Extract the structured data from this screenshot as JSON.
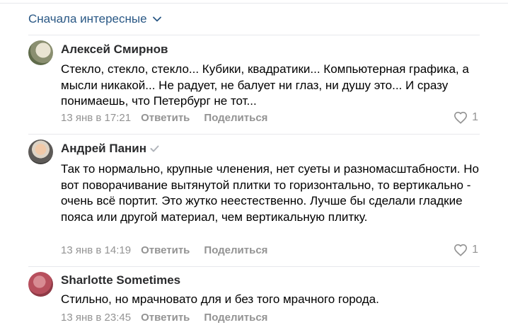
{
  "sort": {
    "label": "Сначала интересные"
  },
  "comments": [
    {
      "author": "Алексей Смирнов",
      "verified": false,
      "text": "Стекло, стекло, стекло... Кубики, квадратики... Компьютерная графика, а мысли никакой... Не радует, не балует ни глаз, ни душу это... И сразу понимаешь, что Петербург не тот...",
      "date": "13 янв в 17:21",
      "reply": "Ответить",
      "share": "Поделиться",
      "likes": "1"
    },
    {
      "author": "Андрей Панин",
      "verified": true,
      "text": "Так то нормально, крупные членения, нет суеты и разномасштабности. Но вот поворачивание вытянутой плитки то горизонтально, то вертикально - очень всё портит. Это жутко неестественно. Лучше бы сделали гладкие пояса или другой материал, чем вертикальную плитку.",
      "date": "13 янв в 14:19",
      "reply": "Ответить",
      "share": "Поделиться",
      "likes": "1"
    },
    {
      "author": "Sharlotte Sometimes",
      "verified": false,
      "text": "Стильно, но мрачновато для и без того мрачного города.",
      "date": "13 янв в 23:45",
      "reply": "Ответить",
      "share": "Поделиться",
      "likes": ""
    }
  ]
}
